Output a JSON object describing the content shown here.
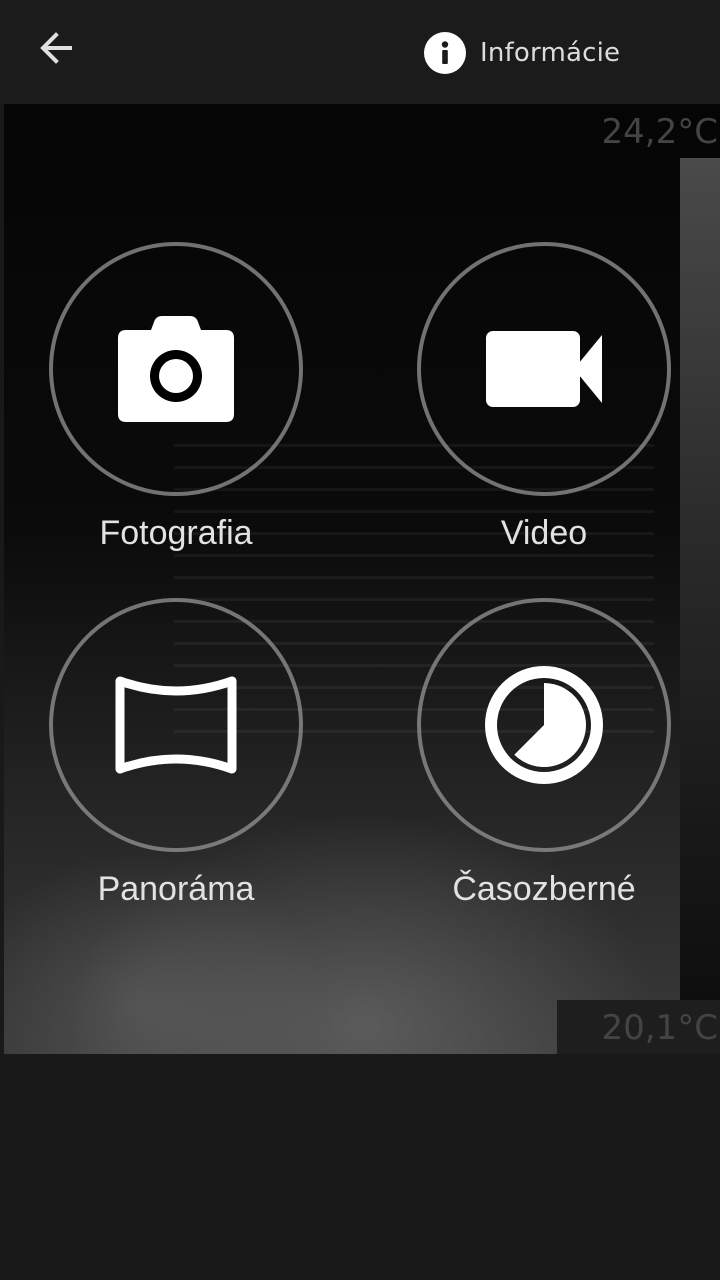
{
  "header": {
    "back_icon": "arrow-left-icon",
    "info_icon": "info-icon",
    "info_label": "Informácie"
  },
  "thermal": {
    "max_temp": "24,2°C",
    "min_temp": "20,1°C"
  },
  "modes": [
    {
      "label": "Fotografia",
      "icon": "camera-icon"
    },
    {
      "label": "Video",
      "icon": "video-camera-icon"
    },
    {
      "label": "Panoráma",
      "icon": "panorama-icon"
    },
    {
      "label": "Časozberné",
      "icon": "timelapse-icon"
    }
  ],
  "colors": {
    "background": "#191919",
    "ring": "#969696",
    "icon": "#ffffff",
    "text": "#e2e2e2"
  }
}
